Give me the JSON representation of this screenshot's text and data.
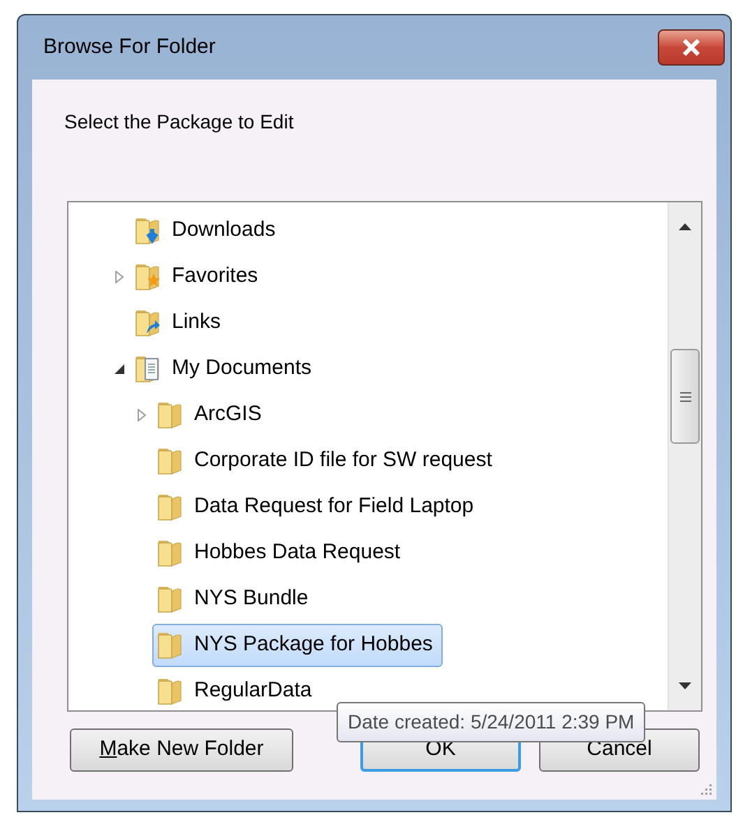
{
  "window": {
    "title": "Browse For Folder"
  },
  "prompt": "Select the Package to Edit",
  "tree": [
    {
      "label": "Downloads",
      "kind": "leaf",
      "selected": false
    },
    {
      "label": "Favorites",
      "kind": "collapsed",
      "selected": false
    },
    {
      "label": "Links",
      "kind": "leaf",
      "selected": false
    },
    {
      "label": "My Documents",
      "kind": "expanded",
      "selected": false,
      "children": [
        {
          "label": "ArcGIS",
          "kind": "collapsed",
          "selected": false
        },
        {
          "label": "Corporate ID file for SW request",
          "kind": "leaf",
          "selected": false
        },
        {
          "label": "Data Request for Field Laptop",
          "kind": "leaf",
          "selected": false
        },
        {
          "label": "Hobbes Data Request",
          "kind": "leaf",
          "selected": false
        },
        {
          "label": "NYS Bundle",
          "kind": "leaf",
          "selected": false
        },
        {
          "label": "NYS Package for Hobbes",
          "kind": "leaf",
          "selected": true
        },
        {
          "label": "RegularData",
          "kind": "leaf",
          "selected": false
        }
      ]
    }
  ],
  "tooltip": "Date created: 5/24/2011 2:39 PM",
  "buttons": [
    {
      "label": "Make New Folder",
      "mnemonic": true,
      "default": false
    },
    {
      "label": "OK",
      "mnemonic": false,
      "default": true
    },
    {
      "label": "Cancel",
      "mnemonic": false,
      "default": false
    }
  ]
}
